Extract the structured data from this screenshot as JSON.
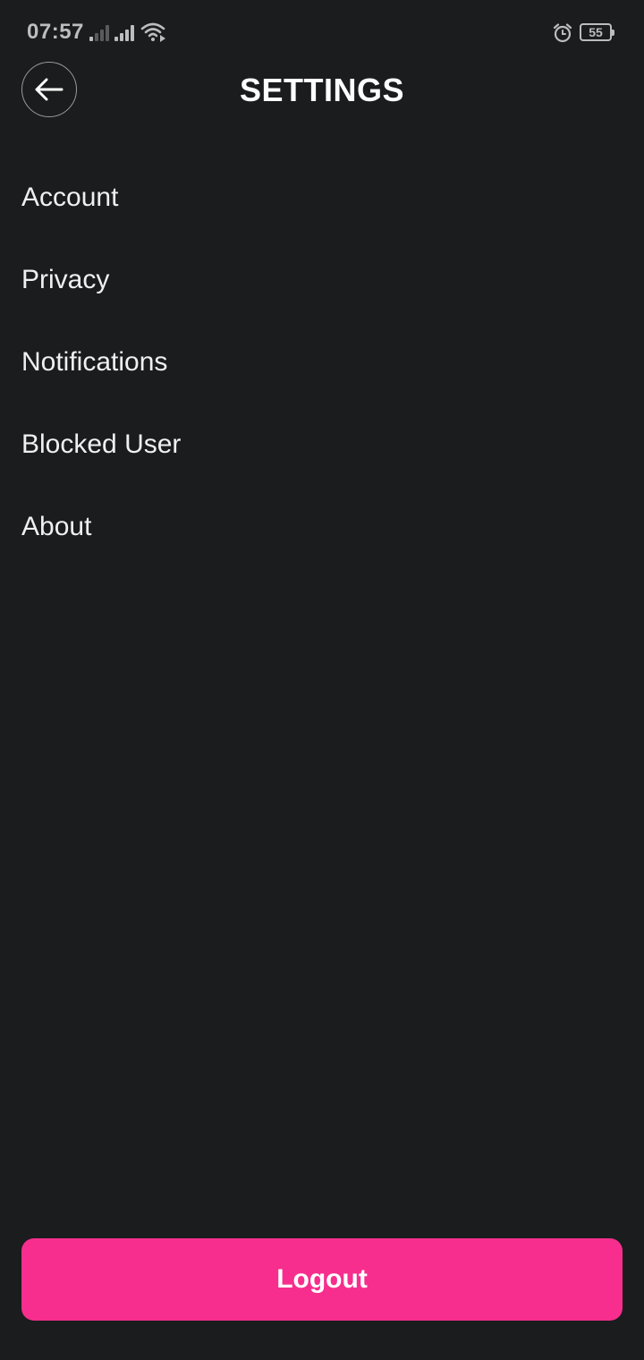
{
  "status_bar": {
    "time": "07:57",
    "battery": "55",
    "icons": [
      "signal-icon",
      "signal-icon",
      "wifi-icon",
      "alarm-icon",
      "battery-icon"
    ]
  },
  "header": {
    "title": "SETTINGS",
    "back_icon": "arrow-left-icon"
  },
  "menu": {
    "items": [
      {
        "label": "Account"
      },
      {
        "label": "Privacy"
      },
      {
        "label": "Notifications"
      },
      {
        "label": "Blocked User"
      },
      {
        "label": "About"
      }
    ]
  },
  "logout": {
    "label": "Logout"
  },
  "colors": {
    "background": "#1b1c1e",
    "accent": "#f72e8d",
    "text": "#ffffff"
  }
}
